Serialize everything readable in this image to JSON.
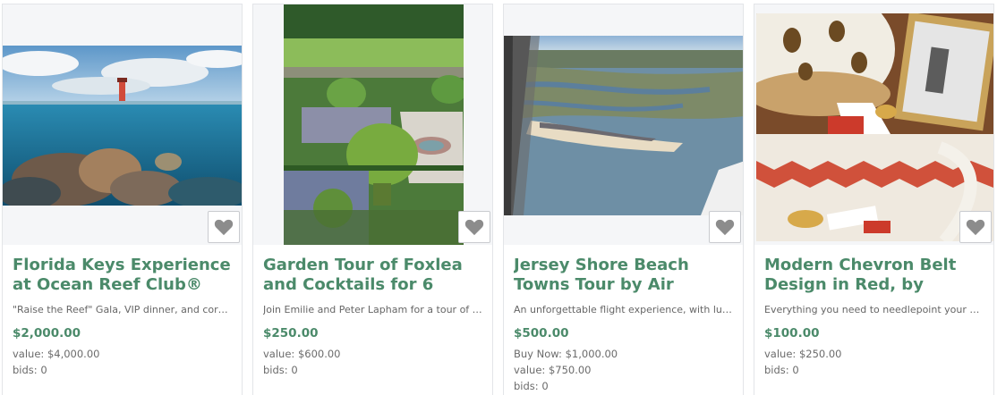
{
  "cards": [
    {
      "title": "Florida Keys Experience at Ocean Reef Club®",
      "description": "\"Raise the Reef\" Gala, VIP dinner, and coral vi...",
      "price": "$2,000.00",
      "meta": [
        "value: $4,000.00",
        "bids: 0"
      ],
      "favorite_icon": "heart-icon"
    },
    {
      "title": "Garden Tour of Foxlea and Cocktails for 6",
      "description": "Join Emilie and Peter Lapham for a tour of th...",
      "price": "$250.00",
      "meta": [
        "value: $600.00",
        "bids: 0"
      ],
      "favorite_icon": "heart-icon"
    },
    {
      "title": "Jersey Shore Beach Towns Tour by Air",
      "description": "An unforgettable flight experience, with lunc...",
      "price": "$500.00",
      "meta": [
        "Buy Now: $1,000.00",
        "value: $750.00",
        "bids: 0"
      ],
      "favorite_icon": "heart-icon"
    },
    {
      "title": "Modern Chevron Belt Design in Red, by Lady...",
      "description": "Everything you need to needlepoint your ow...",
      "price": "$100.00",
      "meta": [
        "value: $250.00",
        "bids: 0"
      ],
      "favorite_icon": "heart-icon"
    }
  ],
  "colors": {
    "accent_green": "#4b8a6a",
    "heart_gray": "#8c8c8c"
  }
}
